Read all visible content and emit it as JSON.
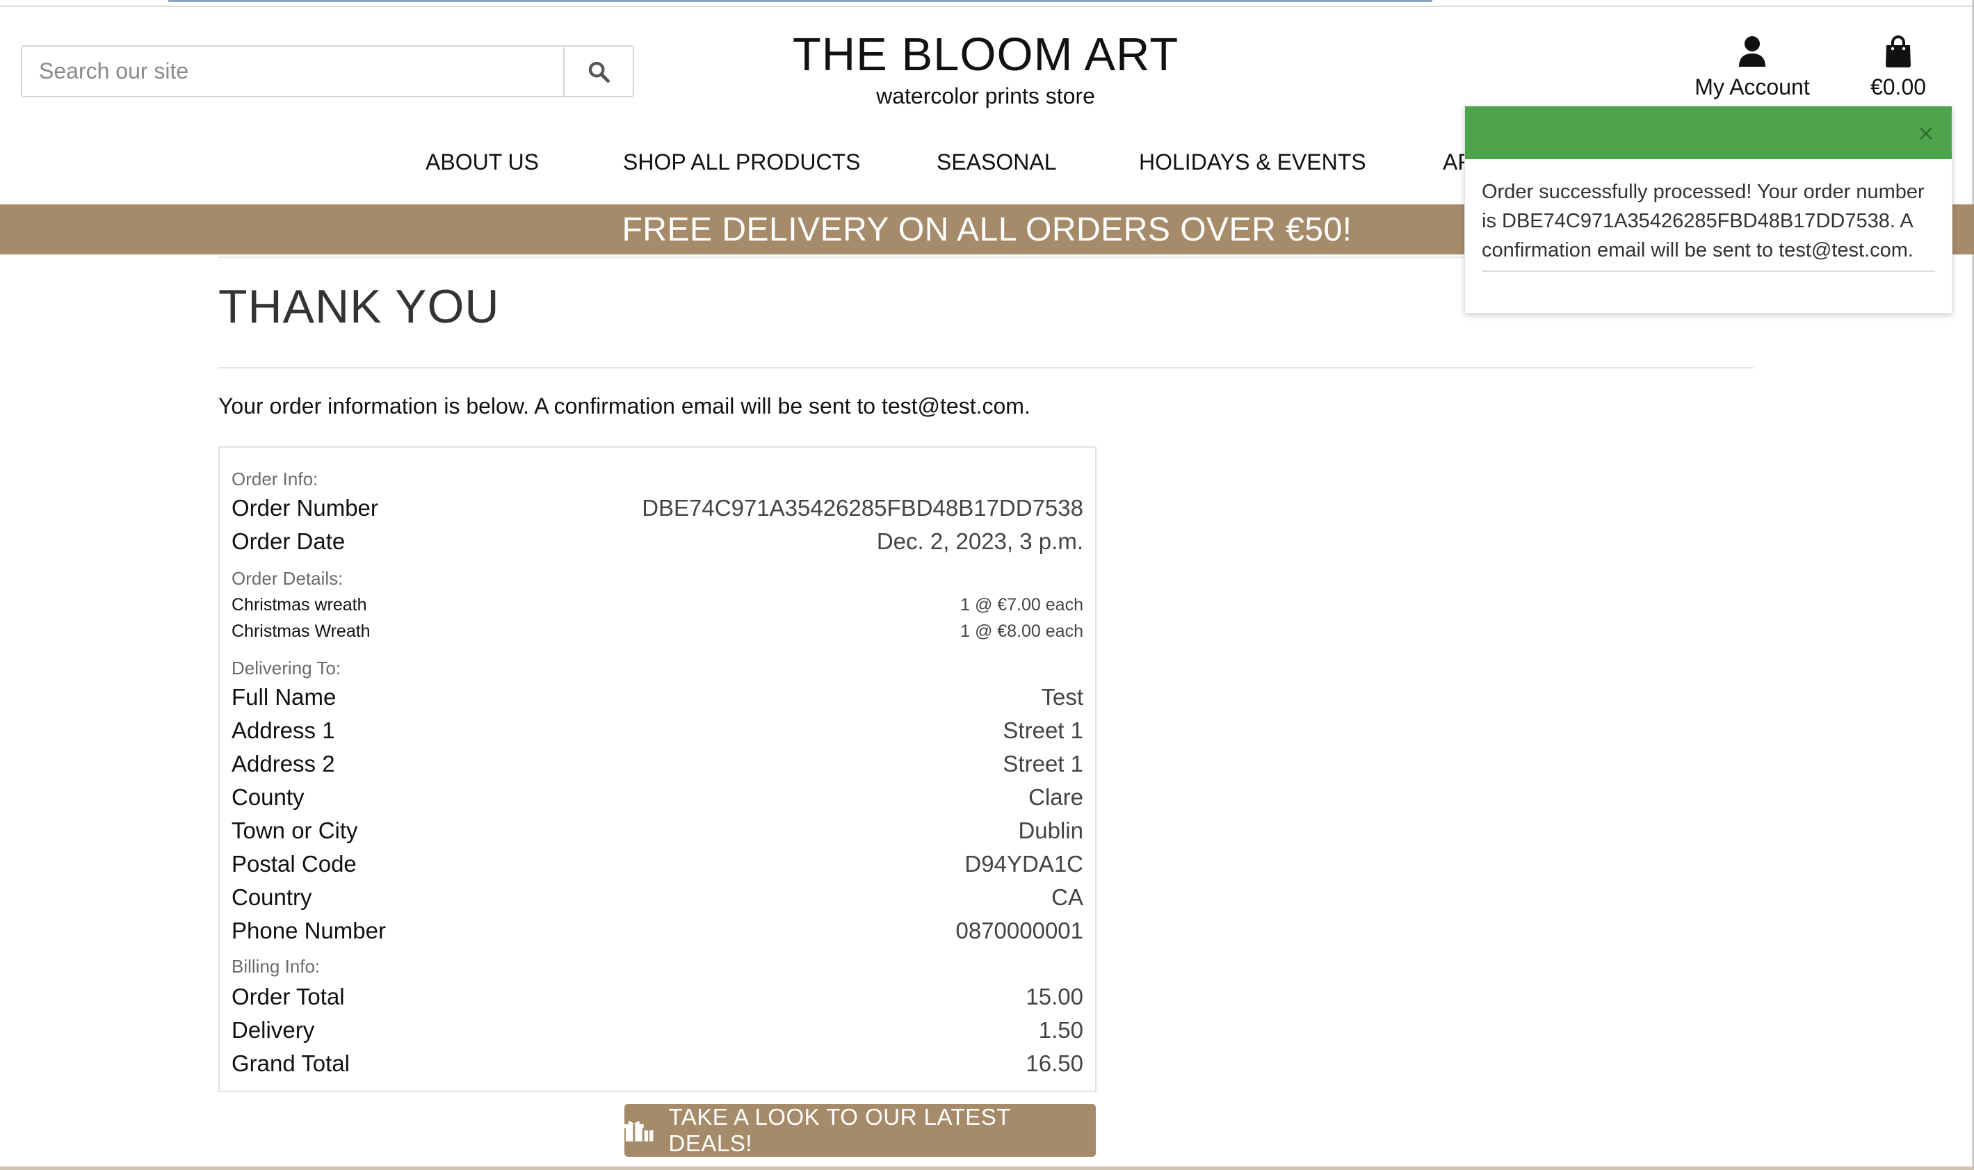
{
  "search": {
    "placeholder": "Search our site"
  },
  "brand": {
    "title": "THE BLOOM ART",
    "subtitle": "watercolor prints store"
  },
  "account": {
    "label": "My Account"
  },
  "bag": {
    "total": "€0.00"
  },
  "nav": {
    "items": [
      {
        "label": "ABOUT US"
      },
      {
        "label": "SHOP ALL PRODUCTS"
      },
      {
        "label": "SEASONAL"
      },
      {
        "label": "HOLIDAYS & EVENTS"
      },
      {
        "label": "AR"
      }
    ]
  },
  "banner": {
    "text": "FREE DELIVERY ON ALL ORDERS OVER €50!"
  },
  "page": {
    "title": "THANK YOU",
    "intro": "Your order information is below. A confirmation email will be sent to test@test.com."
  },
  "order": {
    "info_label": "Order Info:",
    "number_label": "Order Number",
    "number": "DBE74C971A35426285FBD48B17DD7538",
    "date_label": "Order Date",
    "date": "Dec. 2, 2023, 3 p.m.",
    "details_label": "Order Details:",
    "items": [
      {
        "name": "Christmas wreath",
        "qty": "1 @ €7.00 each"
      },
      {
        "name": "Christmas Wreath",
        "qty": "1 @ €8.00 each"
      }
    ],
    "delivering_label": "Delivering To:",
    "delivery": [
      {
        "label": "Full Name",
        "value": "Test"
      },
      {
        "label": "Address 1",
        "value": "Street 1"
      },
      {
        "label": "Address 2",
        "value": "Street 1"
      },
      {
        "label": "County",
        "value": "Clare"
      },
      {
        "label": "Town or City",
        "value": "Dublin"
      },
      {
        "label": "Postal Code",
        "value": "D94YDA1C"
      },
      {
        "label": "Country",
        "value": "CA"
      },
      {
        "label": "Phone Number",
        "value": "0870000001"
      }
    ],
    "billing_label": "Billing Info:",
    "billing": [
      {
        "label": "Order Total",
        "value": "15.00"
      },
      {
        "label": "Delivery",
        "value": "1.50"
      },
      {
        "label": "Grand Total",
        "value": "16.50"
      }
    ]
  },
  "deals_button": {
    "label": "TAKE A LOOK TO OUR LATEST DEALS!"
  },
  "toast": {
    "message": "Order successfully processed! Your order number is DBE74C971A35426285FBD48B17DD7538. A confirmation email will be sent to test@test.com."
  },
  "colors": {
    "brand_brown": "#a58b6a",
    "toast_green": "#4ea44d",
    "text_dark": "#111111"
  },
  "icons": [
    "search-icon",
    "user-icon",
    "shopping-bag-icon",
    "close-icon",
    "gift-icon"
  ]
}
